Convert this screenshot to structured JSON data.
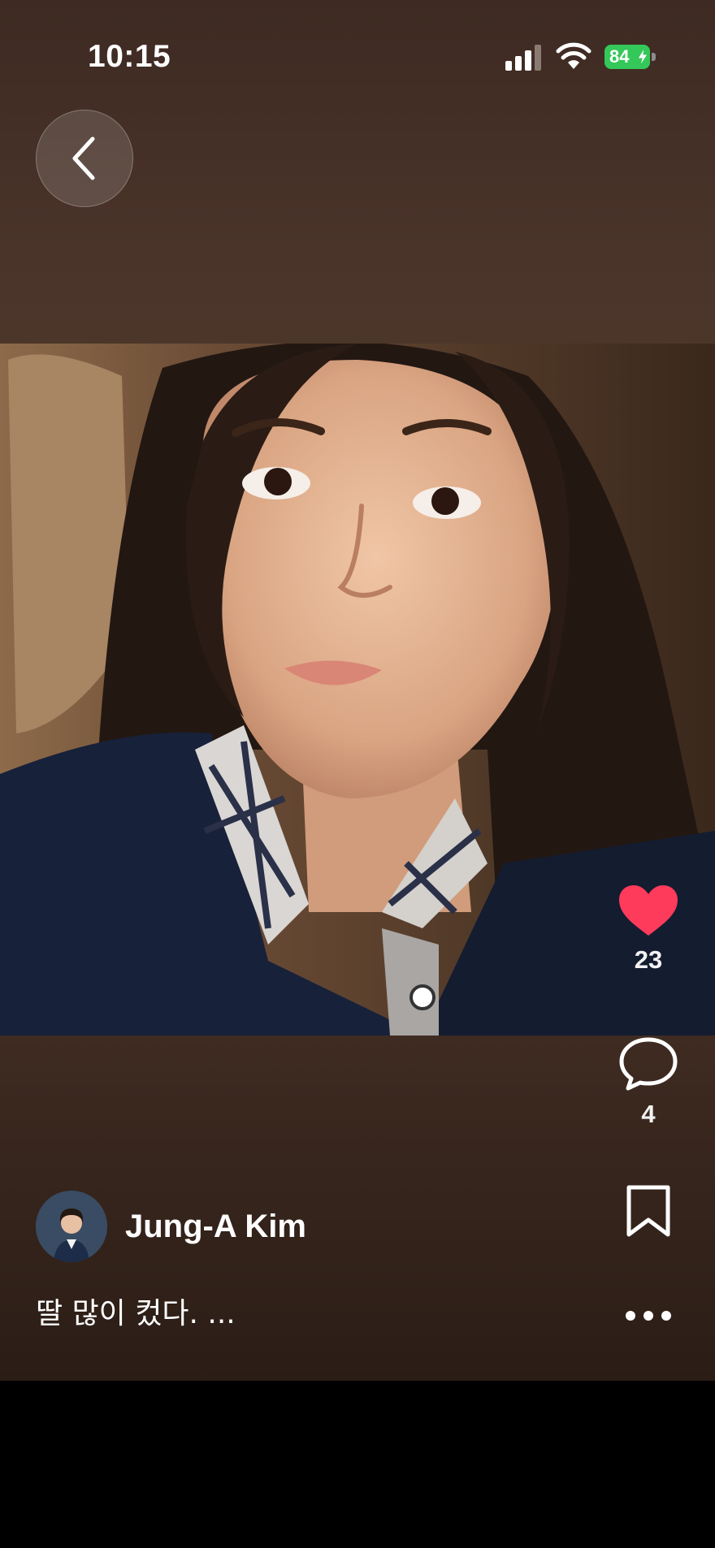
{
  "status_bar": {
    "time": "10:15",
    "battery_percent": "84",
    "cellular_bars": 3,
    "charging": true
  },
  "navigation": {
    "back_icon": "chevron-left-icon"
  },
  "post": {
    "photo_alt": "selfie photo",
    "author": {
      "name": "Jung-A Kim"
    },
    "caption": "딸 많이 컸다. ...",
    "likes": {
      "count": "23",
      "liked": true,
      "color": "#ff3b5c",
      "icon": "heart-icon"
    },
    "comments": {
      "count": "4",
      "icon": "speech-bubble-icon"
    },
    "save_icon": "bookmark-icon",
    "more_icon": "ellipsis-icon"
  },
  "colors": {
    "background_top": "#3d2a22",
    "background_bottom": "#2b1d16",
    "battery": "#34c759"
  }
}
